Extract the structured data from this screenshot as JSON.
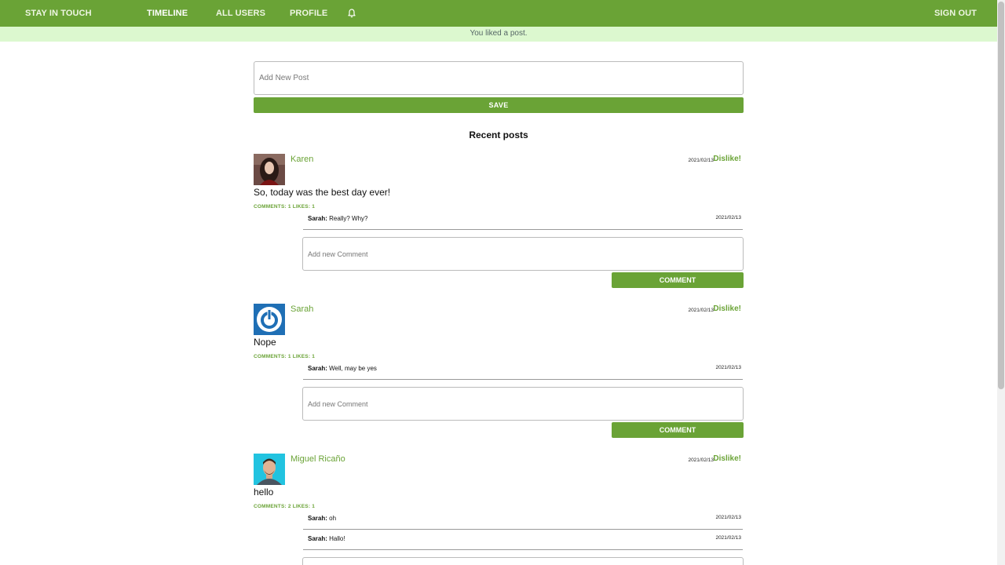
{
  "nav": {
    "brand": "STAY IN TOUCH",
    "timeline": "TIMELINE",
    "all_users": "ALL USERS",
    "profile": "PROFILE",
    "notifications_icon": "bell-icon",
    "sign_out": "SIGN OUT"
  },
  "flash": "You liked a post.",
  "new_post": {
    "placeholder": "Add New Post",
    "save_label": "SAVE"
  },
  "recent_title": "Recent posts",
  "comment_form": {
    "placeholder": "Add new Comment",
    "button_label": "COMMENT"
  },
  "posts": [
    {
      "author": "Karen",
      "date": "2021/02/13",
      "dislike": "Dislike!",
      "body": "So, today was the best day ever!",
      "meta": "COMMENTS: 1 LIKES: 1",
      "comments": [
        {
          "author": "Sarah:",
          "text": "Really? Why?",
          "date": "2021/02/13"
        }
      ]
    },
    {
      "author": "Sarah",
      "date": "2021/02/13",
      "dislike": "Dislike!",
      "body": "Nope",
      "meta": "COMMENTS: 1 LIKES: 1",
      "comments": [
        {
          "author": "Sarah:",
          "text": "Well, may be yes",
          "date": "2021/02/13"
        }
      ]
    },
    {
      "author": "Miguel Ricaño",
      "date": "2021/02/13",
      "dislike": "Dislike!",
      "body": "hello",
      "meta": "COMMENTS: 2 LIKES: 1",
      "comments": [
        {
          "author": "Sarah:",
          "text": "oh",
          "date": "2021/02/13"
        },
        {
          "author": "Sarah:",
          "text": "Hallo!",
          "date": "2021/02/13"
        }
      ]
    }
  ],
  "colors": {
    "primary": "#6aa336",
    "flash_bg": "#dcf8cf"
  }
}
